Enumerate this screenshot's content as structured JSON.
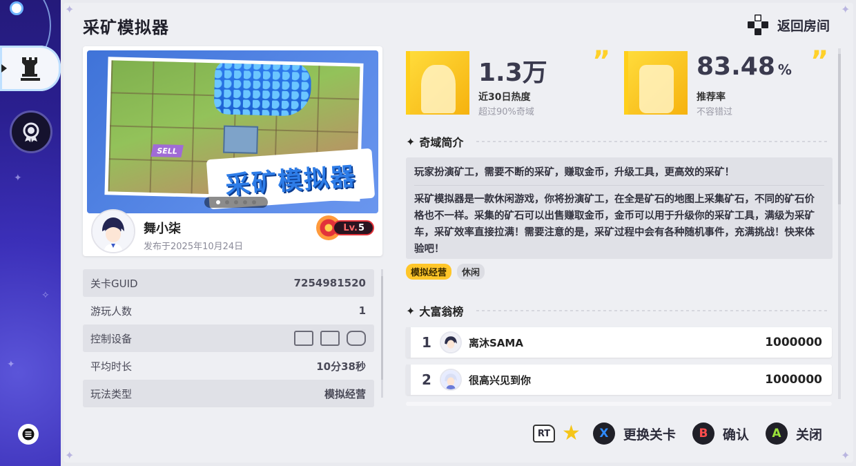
{
  "page": {
    "title": "采矿模拟器",
    "back_label": "返回房间"
  },
  "cover": {
    "logo_text": "采矿模拟器",
    "sign_text": "SELL",
    "slides": 5,
    "active_slide": 1
  },
  "author": {
    "name": "舞小柒",
    "published": "发布于2025年10月24日",
    "level_prefix": "Lv.",
    "level": "5"
  },
  "info": {
    "rows": [
      {
        "label": "关卡GUID",
        "value": "7254981520"
      },
      {
        "label": "游玩人数",
        "value": "1"
      },
      {
        "label": "控制设备",
        "value": "",
        "icons": [
          "pc-mouse-icon",
          "keyboard-mouse-icon",
          "gamepad-icon"
        ]
      },
      {
        "label": "平均时长",
        "value": "10分38秒"
      },
      {
        "label": "玩法类型",
        "value": "模拟经营"
      }
    ]
  },
  "stats": {
    "heat": {
      "value": "1.3万",
      "label": "近30日热度",
      "sub": "超过90%奇域"
    },
    "recommend": {
      "value": "83.48",
      "unit": "%",
      "label": "推荐率",
      "sub": "不容错过"
    }
  },
  "intro": {
    "title": "奇域简介",
    "summary": "玩家扮演矿工，需要不断的采矿，赚取金币，升级工具，更高效的采矿！",
    "body": "采矿模拟器是一款休闲游戏，你将扮演矿工，在全是矿石的地图上采集矿石，不同的矿石价格也不一样。采集的矿石可以出售赚取金币，金币可以用于升级你的采矿工具，满级为采矿车，采矿效率直接拉满！需要注意的是，采矿过程中会有各种随机事件，充满挑战！快来体验吧！",
    "tags": [
      "模拟经营",
      "休闲"
    ]
  },
  "leaderboard": {
    "title": "大富翁榜",
    "entries": [
      {
        "rank": "1",
        "name": "离沐SAMA",
        "score": "1000000"
      },
      {
        "rank": "2",
        "name": "很高兴见到你",
        "score": "1000000"
      }
    ]
  },
  "controls": {
    "rt_label": "RT",
    "change": {
      "key": "X",
      "label": "更换关卡"
    },
    "confirm": {
      "key": "B",
      "label": "确认"
    },
    "close": {
      "key": "A",
      "label": "关闭"
    }
  },
  "colors": {
    "accent_yellow": "#ffc629",
    "x_key": "#2f8bff",
    "b_key": "#ff4d4d",
    "a_key": "#9be33a",
    "rail": "#2a1f8f"
  }
}
